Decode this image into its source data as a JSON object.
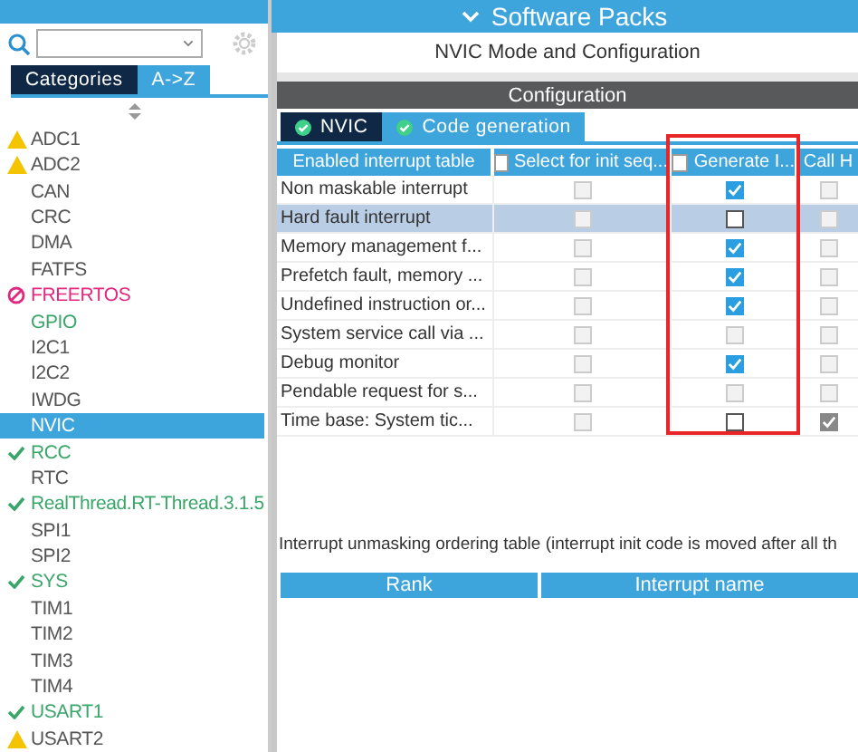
{
  "left_tabs": [
    {
      "label": "Categories",
      "selected": false
    },
    {
      "label": "A->Z",
      "selected": true
    }
  ],
  "peripherals": [
    {
      "name": "ADC1",
      "kind": "warning",
      "selected": false
    },
    {
      "name": "ADC2",
      "kind": "warning",
      "selected": false
    },
    {
      "name": "CAN",
      "kind": "plain",
      "selected": false
    },
    {
      "name": "CRC",
      "kind": "plain",
      "selected": false
    },
    {
      "name": "DMA",
      "kind": "plain",
      "selected": false
    },
    {
      "name": "FATFS",
      "kind": "plain",
      "selected": false
    },
    {
      "name": "FREERTOS",
      "kind": "error",
      "selected": false
    },
    {
      "name": "GPIO",
      "kind": "enabled",
      "selected": false
    },
    {
      "name": "I2C1",
      "kind": "plain",
      "selected": false
    },
    {
      "name": "I2C2",
      "kind": "plain",
      "selected": false
    },
    {
      "name": "IWDG",
      "kind": "plain",
      "selected": false
    },
    {
      "name": "NVIC",
      "kind": "plain",
      "selected": true
    },
    {
      "name": "RCC",
      "kind": "ok",
      "selected": false
    },
    {
      "name": "RTC",
      "kind": "plain",
      "selected": false
    },
    {
      "name": "RealThread.RT-Thread.3.1.5",
      "kind": "ok",
      "selected": false
    },
    {
      "name": "SPI1",
      "kind": "plain",
      "selected": false
    },
    {
      "name": "SPI2",
      "kind": "plain",
      "selected": false
    },
    {
      "name": "SYS",
      "kind": "ok",
      "selected": false
    },
    {
      "name": "TIM1",
      "kind": "plain",
      "selected": false
    },
    {
      "name": "TIM2",
      "kind": "plain",
      "selected": false
    },
    {
      "name": "TIM3",
      "kind": "plain",
      "selected": false
    },
    {
      "name": "TIM4",
      "kind": "plain",
      "selected": false
    },
    {
      "name": "USART1",
      "kind": "ok",
      "selected": false
    },
    {
      "name": "USART2",
      "kind": "warning",
      "selected": false
    }
  ],
  "top_bar": {
    "title": "Software Packs"
  },
  "mode_title": "NVIC Mode and Configuration",
  "config_title": "Configuration",
  "config_tabs": [
    {
      "label": "NVIC",
      "selected": false
    },
    {
      "label": "Code generation",
      "selected": true
    }
  ],
  "table": {
    "columns": [
      {
        "label": "Enabled interrupt table",
        "kind": "plain"
      },
      {
        "label": "Select for init seq...",
        "kind": "selectable",
        "checked": false
      },
      {
        "label": "Generate I...",
        "kind": "selectable",
        "checked": false
      },
      {
        "label": "Call H",
        "kind": "plain"
      }
    ],
    "rows": [
      {
        "name": "Non maskable interrupt",
        "selected": false,
        "cells": [
          {
            "checked": false,
            "disabled": true
          },
          {
            "checked": true,
            "disabled": false
          },
          {
            "checked": false,
            "disabled": true
          }
        ]
      },
      {
        "name": "Hard fault interrupt",
        "selected": true,
        "cells": [
          {
            "checked": false,
            "disabled": true
          },
          {
            "checked": false,
            "disabled": false
          },
          {
            "checked": false,
            "disabled": true
          }
        ]
      },
      {
        "name": "Memory management f...",
        "selected": false,
        "cells": [
          {
            "checked": false,
            "disabled": true
          },
          {
            "checked": true,
            "disabled": false
          },
          {
            "checked": false,
            "disabled": true
          }
        ]
      },
      {
        "name": "Prefetch fault, memory ...",
        "selected": false,
        "cells": [
          {
            "checked": false,
            "disabled": true
          },
          {
            "checked": true,
            "disabled": false
          },
          {
            "checked": false,
            "disabled": true
          }
        ]
      },
      {
        "name": "Undefined instruction or...",
        "selected": false,
        "cells": [
          {
            "checked": false,
            "disabled": true
          },
          {
            "checked": true,
            "disabled": false
          },
          {
            "checked": false,
            "disabled": true
          }
        ]
      },
      {
        "name": "System service call via ...",
        "selected": false,
        "cells": [
          {
            "checked": false,
            "disabled": true
          },
          {
            "checked": false,
            "disabled": true
          },
          {
            "checked": false,
            "disabled": true
          }
        ]
      },
      {
        "name": "Debug monitor",
        "selected": false,
        "cells": [
          {
            "checked": false,
            "disabled": true
          },
          {
            "checked": true,
            "disabled": false
          },
          {
            "checked": false,
            "disabled": true
          }
        ]
      },
      {
        "name": "Pendable request for s...",
        "selected": false,
        "cells": [
          {
            "checked": false,
            "disabled": true
          },
          {
            "checked": false,
            "disabled": true
          },
          {
            "checked": false,
            "disabled": true
          }
        ]
      },
      {
        "name": "Time base: System tic...",
        "selected": false,
        "cells": [
          {
            "checked": false,
            "disabled": true
          },
          {
            "checked": false,
            "disabled": false
          },
          {
            "checked": true,
            "disabled": true
          }
        ]
      }
    ]
  },
  "ordering_note": "Interrupt unmasking ordering table (interrupt init code is moved after all th",
  "ordering_table": {
    "columns": [
      "Rank",
      "Interrupt name"
    ]
  }
}
